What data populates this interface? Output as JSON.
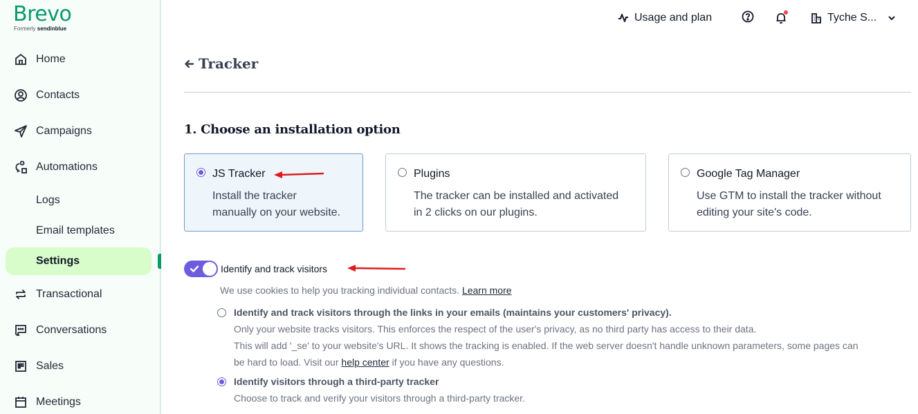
{
  "brand": {
    "name": "Brevo",
    "formerly_label": "Formerly",
    "formerly_name": "sendinblue",
    "color": "#0b996e"
  },
  "sidebar": {
    "items": [
      {
        "label": "Home",
        "icon": "home-icon"
      },
      {
        "label": "Contacts",
        "icon": "contacts-icon"
      },
      {
        "label": "Campaigns",
        "icon": "send-icon"
      },
      {
        "label": "Automations",
        "icon": "automations-icon"
      },
      {
        "label": "Logs",
        "icon": ""
      },
      {
        "label": "Email templates",
        "icon": ""
      },
      {
        "label": "Settings",
        "icon": "",
        "active": true
      },
      {
        "label": "Transactional",
        "icon": "transactional-icon"
      },
      {
        "label": "Conversations",
        "icon": "conversations-icon"
      },
      {
        "label": "Sales",
        "icon": "sales-icon"
      },
      {
        "label": "Meetings",
        "icon": "calendar-icon"
      }
    ],
    "active_color": "#d9fccb"
  },
  "topbar": {
    "usage_label": "Usage and plan",
    "account_label": "Tyche S...",
    "notification_dot_color": "#e5484d"
  },
  "page": {
    "title": "Tracker",
    "section_title": "1. Choose an installation option",
    "options": [
      {
        "title": "JS Tracker",
        "desc_line1": "Install the tracker",
        "desc_line2": "manually on your website.",
        "selected": true
      },
      {
        "title": "Plugins",
        "desc_line1": "The tracker can be installed and activated",
        "desc_line2": "in 2 clicks on our plugins.",
        "selected": false
      },
      {
        "title": "Google Tag Manager",
        "desc_line1": "Use GTM to install the tracker without",
        "desc_line2": "editing your site's code.",
        "selected": false
      }
    ],
    "toggle": {
      "label": "Identify and track visitors",
      "enabled": true,
      "color": "#6d5ce0"
    },
    "cookie_note": "We use cookies to help you tracking individual contacts.",
    "learn_more": "Learn more",
    "tracking_modes": [
      {
        "title": "Identify and track visitors through the links in your emails (maintains your customers' privacy).",
        "line1": "Only your website tracks visitors. This enforces the respect of the user's privacy, as no third party has access to their data.",
        "line2": "This will add '_se' to your website's URL. It shows the tracking is enabled. If the web server doesn't handle unknown parameters, some pages can",
        "line3_before": "be hard to load. Visit our",
        "line3_link": "help center",
        "line3_after": "if you have any questions.",
        "selected": false
      },
      {
        "title": "Identify visitors through a third-party tracker",
        "line1": "Choose to track and verify your visitors through a third-party tracker.",
        "selected": true
      }
    ]
  },
  "annotations": {
    "arrow_color": "#e01b1b"
  }
}
